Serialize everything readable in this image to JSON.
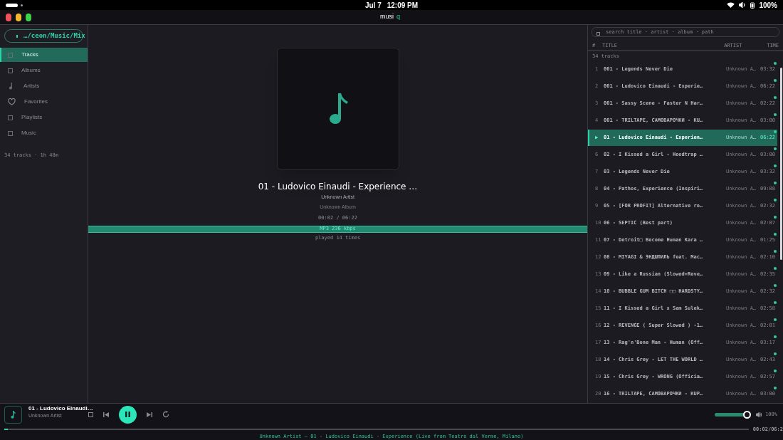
{
  "system_bar": {
    "date": "Jul 7",
    "time": "12:09 PM",
    "battery": "100%"
  },
  "window": {
    "title": "musi",
    "title_accent": "q"
  },
  "sidebar": {
    "folder": "…/ceon/Music/Mix",
    "items": [
      {
        "label": "Tracks",
        "kind": "square",
        "selected": true
      },
      {
        "label": "Albums",
        "kind": "square",
        "selected": false
      },
      {
        "label": "Artists",
        "kind": "note",
        "selected": false
      },
      {
        "label": "Favorites",
        "kind": "heart",
        "selected": false
      },
      {
        "label": "Playlists",
        "kind": "square",
        "selected": false
      },
      {
        "label": "Music",
        "kind": "square",
        "selected": false
      }
    ],
    "summary": "34 tracks · 1h 48m"
  },
  "now_playing": {
    "title": "01 - Ludovico Einaudi - Experience …",
    "artist": "Unknown Artist",
    "album": "Unknown Album",
    "position": "00:02 / 06:22",
    "format": "MP3  236 kbps",
    "play_count": "played 14 times"
  },
  "track_list": {
    "search_placeholder": "search title · artist · album · path",
    "columns": [
      "#",
      "TITLE",
      "ARTIST",
      "TIME"
    ],
    "count": "34 tracks",
    "rows": [
      {
        "number": "1",
        "title": "001 - Legends Never Die",
        "artist": "Unknown A…",
        "time": "03:32",
        "selected": false
      },
      {
        "number": "2",
        "title": "001 - Ludovico Einaudi - Experie…",
        "artist": "Unknown A…",
        "time": "06:22",
        "selected": false
      },
      {
        "number": "3",
        "title": "001 - Sassy Scene - Faster N Har…",
        "artist": "Unknown A…",
        "time": "02:22",
        "selected": false
      },
      {
        "number": "4",
        "title": "001 - TRILTAPE, САМОВАРОЧКИ - KU…",
        "artist": "Unknown A…",
        "time": "03:00",
        "selected": false
      },
      {
        "number": "▶",
        "title": "01 - Ludovico Einaudi - Experien…",
        "artist": "Unknown A…",
        "time": "06:22",
        "selected": true
      },
      {
        "number": "6",
        "title": "02 - I Kissed a Girl - Hoodtrap …",
        "artist": "Unknown A…",
        "time": "03:00",
        "selected": false
      },
      {
        "number": "7",
        "title": "03 - Legends Never Die",
        "artist": "Unknown A…",
        "time": "03:32",
        "selected": false
      },
      {
        "number": "8",
        "title": "04 - Pathos, Experience (Inspiri…",
        "artist": "Unknown A…",
        "time": "09:08",
        "selected": false
      },
      {
        "number": "9",
        "title": "05 - [FOR PROFIT] Alternative ro…",
        "artist": "Unknown A…",
        "time": "02:32",
        "selected": false
      },
      {
        "number": "10",
        "title": "06 - SEPTIC (Best part)",
        "artist": "Unknown A…",
        "time": "02:07",
        "selected": false
      },
      {
        "number": "11",
        "title": "07 - Detroit□ Become Human Kara …",
        "artist": "Unknown A…",
        "time": "01:25",
        "selected": false
      },
      {
        "number": "12",
        "title": "08 - MIYAGI & ЭНДШПИЛЬ feat. Mac…",
        "artist": "Unknown A…",
        "time": "02:10",
        "selected": false
      },
      {
        "number": "13",
        "title": "09 - Like a Russian (Slowed+Reve…",
        "artist": "Unknown A…",
        "time": "02:35",
        "selected": false
      },
      {
        "number": "14",
        "title": "10 - BUBBLE GUM BITCH □□ HARDSTY…",
        "artist": "Unknown A…",
        "time": "02:32",
        "selected": false
      },
      {
        "number": "15",
        "title": "11 - I Kissed a Girl x Sam Sulek…",
        "artist": "Unknown A…",
        "time": "02:58",
        "selected": false
      },
      {
        "number": "16",
        "title": "12 - REVENGE ( Super Slowed ) -1…",
        "artist": "Unknown A…",
        "time": "02:01",
        "selected": false
      },
      {
        "number": "17",
        "title": "13 - Rag'n'Bone Man - Human (Off…",
        "artist": "Unknown A…",
        "time": "03:17",
        "selected": false
      },
      {
        "number": "18",
        "title": "14 - Chris Grey - LET THE WORLD …",
        "artist": "Unknown A…",
        "time": "02:43",
        "selected": false
      },
      {
        "number": "19",
        "title": "15 - Chris Grey - WRONG (Officia…",
        "artist": "Unknown A…",
        "time": "02:57",
        "selected": false
      },
      {
        "number": "20",
        "title": "16 - TRILTAPE, САМОВАРОЧКИ - KUP…",
        "artist": "Unknown A…",
        "time": "03:00",
        "selected": false
      }
    ]
  },
  "player": {
    "title": "01 - Ludovico Einaudi…",
    "artist": "Unknown Artist",
    "playing": true,
    "volume": {
      "level": 1,
      "reading": "100%"
    },
    "progress": {
      "level": 0.005,
      "reading": "00:02/06:2"
    },
    "status": "Unknown Artist — 01 - Ludovico Einaudi - Experience (Live from Teatro dal Verme, Milano)"
  }
}
